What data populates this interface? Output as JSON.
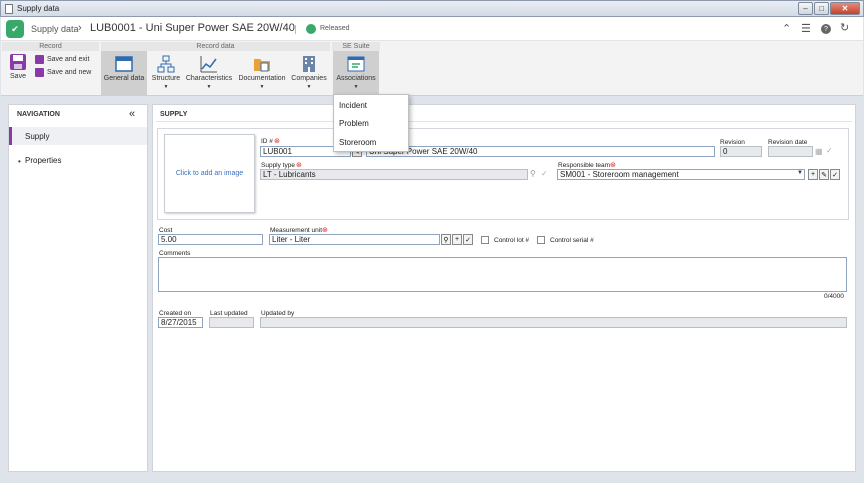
{
  "window": {
    "title": "Supply data"
  },
  "header": {
    "module": "Supply data",
    "record_title": "LUB0001 - Uni Super Power SAE 20W/40",
    "status": "Released"
  },
  "ribbon": {
    "groups": {
      "record": "Record",
      "record_data": "Record data",
      "se_suite": "SE Suite"
    },
    "save": "Save",
    "save_and_exit": "Save and exit",
    "save_and_new": "Save and new",
    "general_data": "General data",
    "structure": "Structure",
    "characteristics": "Characteristics",
    "documentation": "Documentation",
    "companies": "Companies",
    "associations": "Associations"
  },
  "associations_menu": [
    "Incident",
    "Problem",
    "Storeroom"
  ],
  "nav": {
    "title": "NAVIGATION",
    "items": [
      "Supply",
      "Properties"
    ]
  },
  "form": {
    "section": "SUPPLY",
    "image_placeholder": "Click to add an image",
    "id_label": "ID #",
    "id_value": "LUB001",
    "name_value": "Uni Super Power SAE 20W/40",
    "revision_label": "Revision",
    "revision_value": "0",
    "revision_date_label": "Revision date",
    "revision_date_value": "",
    "supply_type_label": "Supply type",
    "supply_type_value": "LT - Lubricants",
    "responsible_team_label": "Responsible team",
    "responsible_team_value": "SM001 - Storeroom management",
    "cost_label": "Cost",
    "cost_value": "5.00",
    "measurement_unit_label": "Measurement unit",
    "measurement_unit_value": "Liter - Liter",
    "control_lot_label": "Control lot #",
    "control_serial_label": "Control serial #",
    "comments_label": "Comments",
    "comments_counter": "0/4000",
    "created_on_label": "Created on",
    "created_on_value": "8/27/2015",
    "last_updated_label": "Last updated",
    "last_updated_value": "",
    "updated_by_label": "Updated by",
    "updated_by_value": ""
  },
  "colors": {
    "brand": "#39a96b",
    "required": "#d62020",
    "link": "#3a6fc4"
  }
}
